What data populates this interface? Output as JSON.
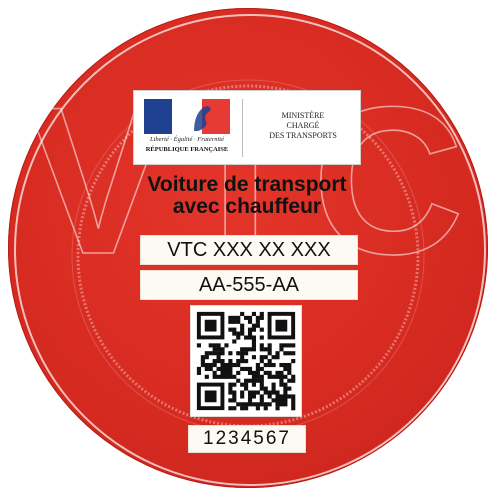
{
  "vignette": {
    "background_letters": "VTC",
    "colors": {
      "disc": "#d72b21",
      "panel": "#fdfaf4",
      "text": "#111111"
    },
    "logo": {
      "motto": "Liberté · Égalité · Fraternité",
      "country": "RÉPUBLIQUE FRANÇAISE",
      "ministry_line1": "MINISTÈRE",
      "ministry_line2": "CHARGÉ",
      "ministry_line3": "DES TRANSPORTS"
    },
    "headline_line1": "Voiture de transport",
    "headline_line2": "avec chauffeur",
    "vtc_number": "VTC XXX XX XXX",
    "plate": "AA-555-AA",
    "serial": "1234567"
  }
}
